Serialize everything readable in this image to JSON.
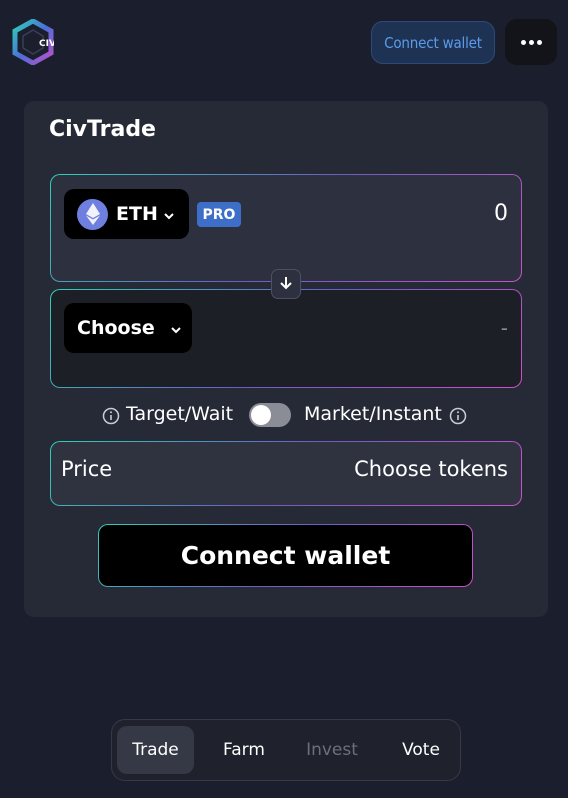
{
  "header": {
    "connect_wallet_label": "Connect wallet",
    "more_icon": "more-dots-icon",
    "logo_text": "CIV"
  },
  "card": {
    "title": "CivTrade",
    "from": {
      "token": "ETH",
      "token_icon": "ethereum-icon",
      "badge": "PRO",
      "amount": "0"
    },
    "to": {
      "token": "Choose",
      "amount": "-"
    },
    "mode": {
      "left_label": "Target/Wait",
      "right_label": "Market/Instant",
      "toggle_on": false
    },
    "price": {
      "label": "Price",
      "value": "Choose tokens"
    },
    "action_label": "Connect wallet"
  },
  "nav": {
    "items": [
      {
        "label": "Trade",
        "active": true
      },
      {
        "label": "Farm",
        "active": false
      },
      {
        "label": "Invest",
        "disabled": true
      },
      {
        "label": "Vote",
        "active": false
      }
    ]
  },
  "colors": {
    "background": "#1b1e2c",
    "card": "#262a36",
    "accent_blue": "#5b9bea",
    "badge": "#3d6fc9",
    "gradient_start": "#2fd0b8",
    "gradient_end": "#d04fc8"
  }
}
